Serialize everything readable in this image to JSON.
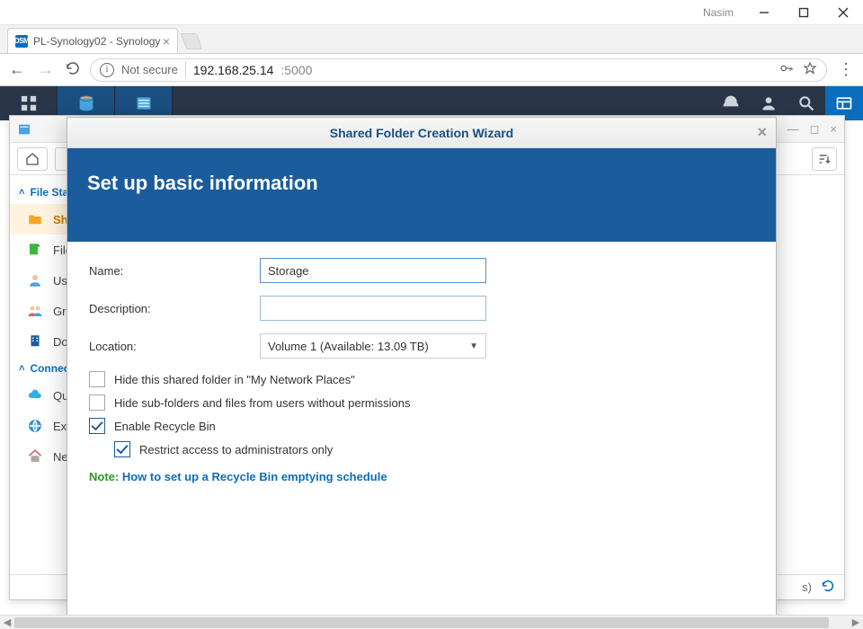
{
  "window": {
    "user": "Nasim"
  },
  "browser": {
    "tab_title": "PL-Synology02 - Synology",
    "tab_favicon_text": "DSM",
    "not_secure_label": "Not secure",
    "url_host": "192.168.25.14",
    "url_port": ":5000"
  },
  "fs": {
    "sections": {
      "file_station": "File Station",
      "connections": "Connections"
    },
    "items": {
      "shared": "Shared Folder",
      "file_services": "File Services",
      "user": "User",
      "group": "Group",
      "domain": "Domain/LDAP",
      "quick": "QuickConnect",
      "external": "External Access",
      "network": "Network"
    },
    "footer_right": "s)"
  },
  "wizard": {
    "title": "Shared Folder Creation Wizard",
    "heading": "Set up basic information",
    "labels": {
      "name": "Name:",
      "description": "Description:",
      "location": "Location:"
    },
    "values": {
      "name": "Storage",
      "description": "",
      "location": "Volume 1 (Available: 13.09 TB)"
    },
    "checkboxes": {
      "hide_network": {
        "label": "Hide this shared folder in \"My Network Places\"",
        "checked": false
      },
      "hide_sub": {
        "label": "Hide sub-folders and files from users without permissions",
        "checked": false
      },
      "recycle": {
        "label": "Enable Recycle Bin",
        "checked": true
      },
      "restrict": {
        "label": "Restrict access to administrators only",
        "checked": true
      }
    },
    "note_label": "Note:",
    "note_link": "How to set up a Recycle Bin emptying schedule"
  }
}
